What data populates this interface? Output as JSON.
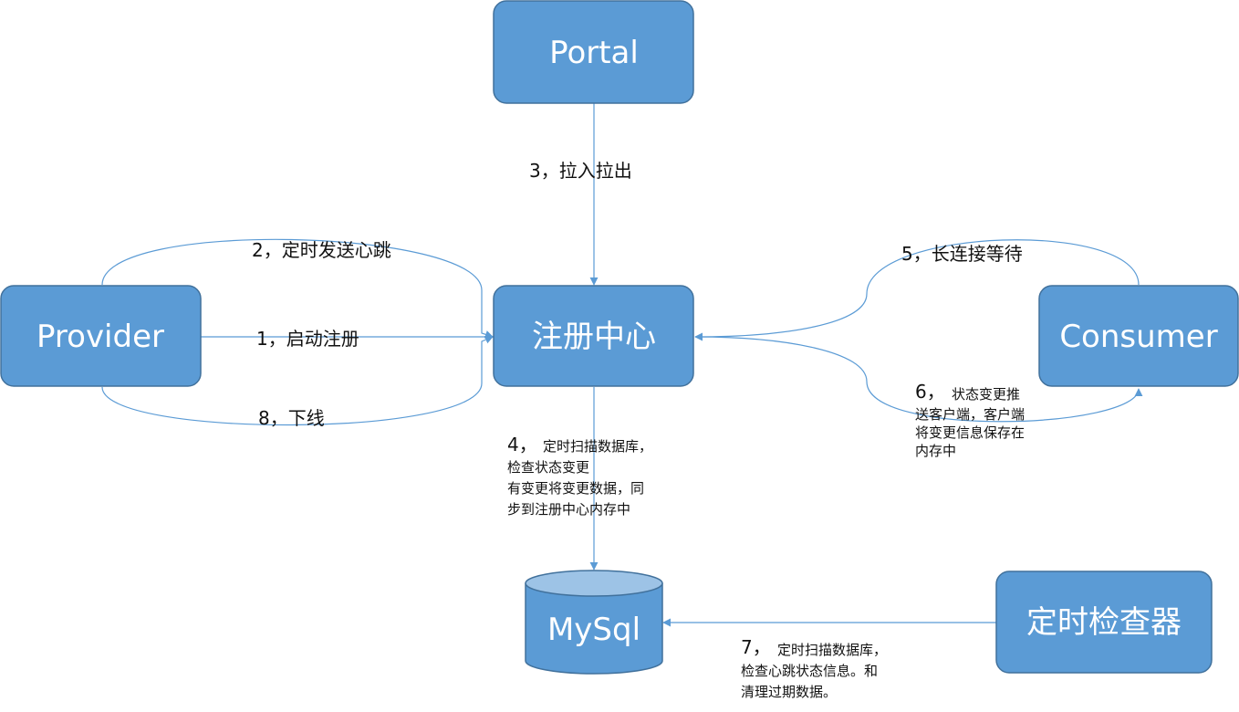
{
  "nodes": {
    "portal": "Portal",
    "provider": "Provider",
    "registry": "注册中心",
    "consumer": "Consumer",
    "mysql": "MySql",
    "checker": "定时检查器"
  },
  "edges": {
    "e1": "1，启动注册",
    "e2": "2，定时发送心跳",
    "e3": "3，拉入拉出",
    "e4_num": "4，",
    "e4_l1": "定时扫描数据库，",
    "e4_l2": "检查状态变更",
    "e4_l3": "有变更将变更数据，同",
    "e4_l4": "步到注册中心内存中",
    "e5": "5，长连接等待",
    "e6_num": "6，",
    "e6_l1": "状态变更推",
    "e6_l2": "送客户端，客户端",
    "e6_l3": "将变更信息保存在",
    "e6_l4": "内存中",
    "e7_num": "7，",
    "e7_l1": "定时扫描数据库，",
    "e7_l2": "检查心跳状态信息。和",
    "e7_l3": "清理过期数据。",
    "e8": "8，下线"
  },
  "colors": {
    "node_fill": "#5b9bd5",
    "node_stroke": "#41719c",
    "connector": "#5b9bd5",
    "db_top": "#9dc3e6",
    "label_text": "#111111"
  }
}
